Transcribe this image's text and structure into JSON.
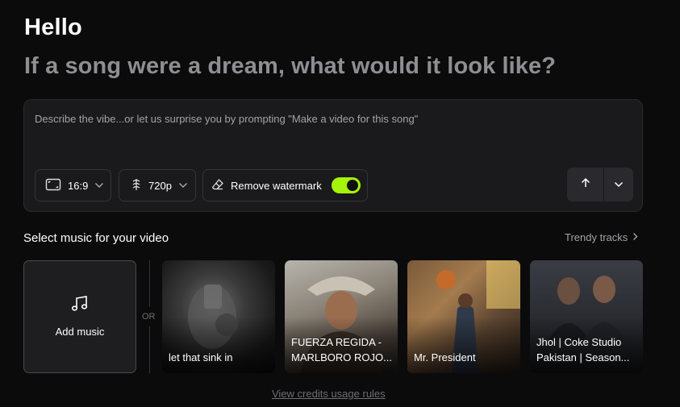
{
  "header": {
    "greeting": "Hello",
    "subtitle": "If a song were a dream, what would it look like?"
  },
  "prompt": {
    "placeholder": "Describe the vibe...or let us surprise you by prompting \"Make a video for this song\""
  },
  "controls": {
    "aspect_ratio": "16:9",
    "resolution": "720p",
    "watermark_label": "Remove watermark",
    "watermark_enabled": true
  },
  "music": {
    "section_title": "Select music for your video",
    "trendy_label": "Trendy tracks",
    "add_label": "Add music",
    "or_label": "OR",
    "tracks": [
      {
        "title": "let that sink in"
      },
      {
        "title": "FUERZA REGIDA - MARLBORO ROJO..."
      },
      {
        "title": "Mr. President"
      },
      {
        "title": "Jhol | Coke Studio Pakistan | Season..."
      }
    ]
  },
  "footer": {
    "credits_link": "View credits usage rules"
  },
  "colors": {
    "accent": "#a6f40a",
    "background": "#0b0b0c",
    "panel": "#1a1a1c",
    "muted_text": "#8e8e93"
  }
}
